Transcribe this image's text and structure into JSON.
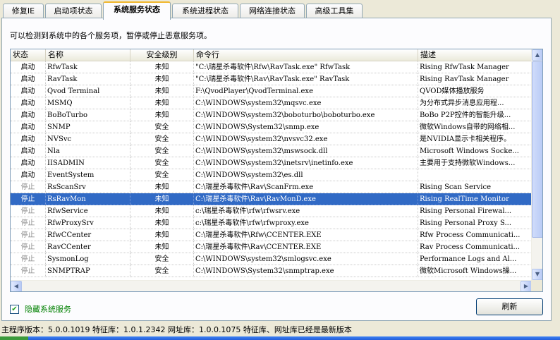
{
  "tabs": [
    {
      "label": "修复IE",
      "active": false
    },
    {
      "label": "启动项状态",
      "active": false
    },
    {
      "label": "系统服务状态",
      "active": true
    },
    {
      "label": "系统进程状态",
      "active": false
    },
    {
      "label": "网络连接状态",
      "active": false
    },
    {
      "label": "高级工具集",
      "active": false
    }
  ],
  "description": "可以检测到系统中的各个服务项，暂停或停止恶意服务项。",
  "columns": {
    "status": "状态",
    "name": "名称",
    "level": "安全级别",
    "command": "命令行",
    "desc": "描述"
  },
  "rows": [
    {
      "status": "启动",
      "name": "RfwTask",
      "level": "未知",
      "command": "\"C:\\瑞星杀毒软件\\Rfw\\RavTask.exe\" RfwTask",
      "desc": "Rising RfwTask Manager"
    },
    {
      "status": "启动",
      "name": "RavTask",
      "level": "未知",
      "command": "\"C:\\瑞星杀毒软件\\Rav\\RavTask.exe\" RavTask",
      "desc": "Rising RavTask Manager"
    },
    {
      "status": "启动",
      "name": "Qvod Terminal",
      "level": "未知",
      "command": "F:\\QvodPlayer\\QvodTerminal.exe",
      "desc": "QVOD媒体播放服务"
    },
    {
      "status": "启动",
      "name": "MSMQ",
      "level": "未知",
      "command": "C:\\WINDOWS\\system32\\mqsvc.exe",
      "desc": "为分布式异步消息应用程..."
    },
    {
      "status": "启动",
      "name": "BoBoTurbo",
      "level": "未知",
      "command": "C:\\WINDOWS\\system32\\boboturbo\\boboturbo.exe",
      "desc": "BoBo P2P控件的智能升级..."
    },
    {
      "status": "启动",
      "name": "SNMP",
      "level": "安全",
      "command": "C:\\WINDOWS\\System32\\snmp.exe",
      "desc": "微软Windows自带的网络相..."
    },
    {
      "status": "启动",
      "name": "NVSvc",
      "level": "安全",
      "command": "C:\\WINDOWS\\system32\\nvsvc32.exe",
      "desc": "是NVIDIA显示卡相关程序。"
    },
    {
      "status": "启动",
      "name": "Nla",
      "level": "安全",
      "command": "C:\\WINDOWS\\system32\\mswsock.dll",
      "desc": "Microsoft Windows Socke..."
    },
    {
      "status": "启动",
      "name": "IISADMIN",
      "level": "安全",
      "command": "C:\\WINDOWS\\system32\\inetsrv\\inetinfo.exe",
      "desc": "主要用于支持微软Windows..."
    },
    {
      "status": "启动",
      "name": "EventSystem",
      "level": "安全",
      "command": "C:\\WINDOWS\\system32\\es.dll",
      "desc": ""
    },
    {
      "status": "停止",
      "name": "RsScanSrv",
      "level": "未知",
      "command": "C:\\瑞星杀毒软件\\Rav\\ScanFrm.exe",
      "desc": "Rising Scan Service"
    },
    {
      "status": "停止",
      "name": "RsRavMon",
      "level": "未知",
      "command": "C:\\瑞星杀毒软件\\Rav\\RavMonD.exe",
      "desc": "Rising RealTime Monitor",
      "selected": true
    },
    {
      "status": "停止",
      "name": "RfwService",
      "level": "未知",
      "command": "c:\\瑞星杀毒软件\\rfw\\rfwsrv.exe",
      "desc": "Rising Personal Firewal..."
    },
    {
      "status": "停止",
      "name": "RfwProxySrv",
      "level": "未知",
      "command": "c:\\瑞星杀毒软件\\rfw\\rfwproxy.exe",
      "desc": "Rising Personal Proxy S..."
    },
    {
      "status": "停止",
      "name": "RfwCCenter",
      "level": "未知",
      "command": "C:\\瑞星杀毒软件\\Rfw\\CCENTER.EXE",
      "desc": "Rfw Process Communicati..."
    },
    {
      "status": "停止",
      "name": "RavCCenter",
      "level": "未知",
      "command": "C:\\瑞星杀毒软件\\Rav\\CCENTER.EXE",
      "desc": "Rav Process Communicati..."
    },
    {
      "status": "停止",
      "name": "SysmonLog",
      "level": "安全",
      "command": "C:\\WINDOWS\\system32\\smlogsvc.exe",
      "desc": "Performance Logs and Al..."
    },
    {
      "status": "停止",
      "name": "SNMPTRAP",
      "level": "安全",
      "command": "C:\\WINDOWS\\System32\\snmptrap.exe",
      "desc": "微软Microsoft Windows操..."
    }
  ],
  "hide_system_services": {
    "label": "隐藏系统服务",
    "checked": true,
    "check_glyph": "✔"
  },
  "refresh_label": "刷新",
  "statusbar": "主程序版本：5.0.0.1019 特征库：1.0.1.2342 网址库：1.0.0.1075 特征库、网址库已经是最新版本",
  "scroll": {
    "up_glyph": "▲",
    "down_glyph": "▼",
    "left_glyph": "◀",
    "right_glyph": "▶"
  }
}
